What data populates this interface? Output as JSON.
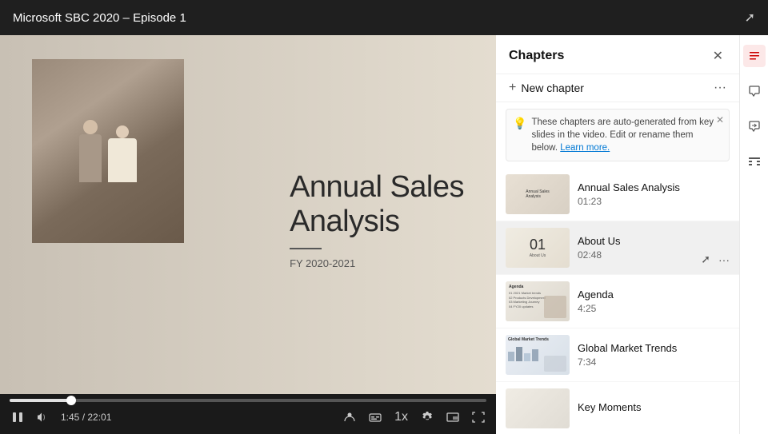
{
  "header": {
    "title": "Microsoft SBC 2020 – Episode 1"
  },
  "video": {
    "current_time": "1:45",
    "total_time": "22:01",
    "progress_percent": 13,
    "speed_label": "1x",
    "slide": {
      "main_title_line1": "Annual Sales",
      "main_title_line2": "Analysis",
      "subtitle": "FY 2020-2021"
    }
  },
  "chapters_panel": {
    "title": "Chapters",
    "add_chapter_label": "New chapter",
    "info_banner": {
      "text": "These chapters are auto-generated from key slides in the video. Edit or rename them below.",
      "link_text": "Learn more."
    },
    "chapters": [
      {
        "id": 1,
        "name": "Annual Sales Analysis",
        "time": "01:23",
        "active": false,
        "thumb_type": "annual"
      },
      {
        "id": 2,
        "name": "About Us",
        "time": "02:48",
        "active": true,
        "thumb_type": "aboutus"
      },
      {
        "id": 3,
        "name": "Agenda",
        "time": "4:25",
        "active": false,
        "thumb_type": "agenda"
      },
      {
        "id": 4,
        "name": "Global Market Trends",
        "time": "7:34",
        "active": false,
        "thumb_type": "global"
      },
      {
        "id": 5,
        "name": "Key Moments",
        "time": "",
        "active": false,
        "thumb_type": "key"
      }
    ]
  },
  "sidebar_icons": {
    "chapters_icon": "☰",
    "comments_icon": "💬",
    "reply_icon": "↩",
    "info_icon": "⊟"
  }
}
